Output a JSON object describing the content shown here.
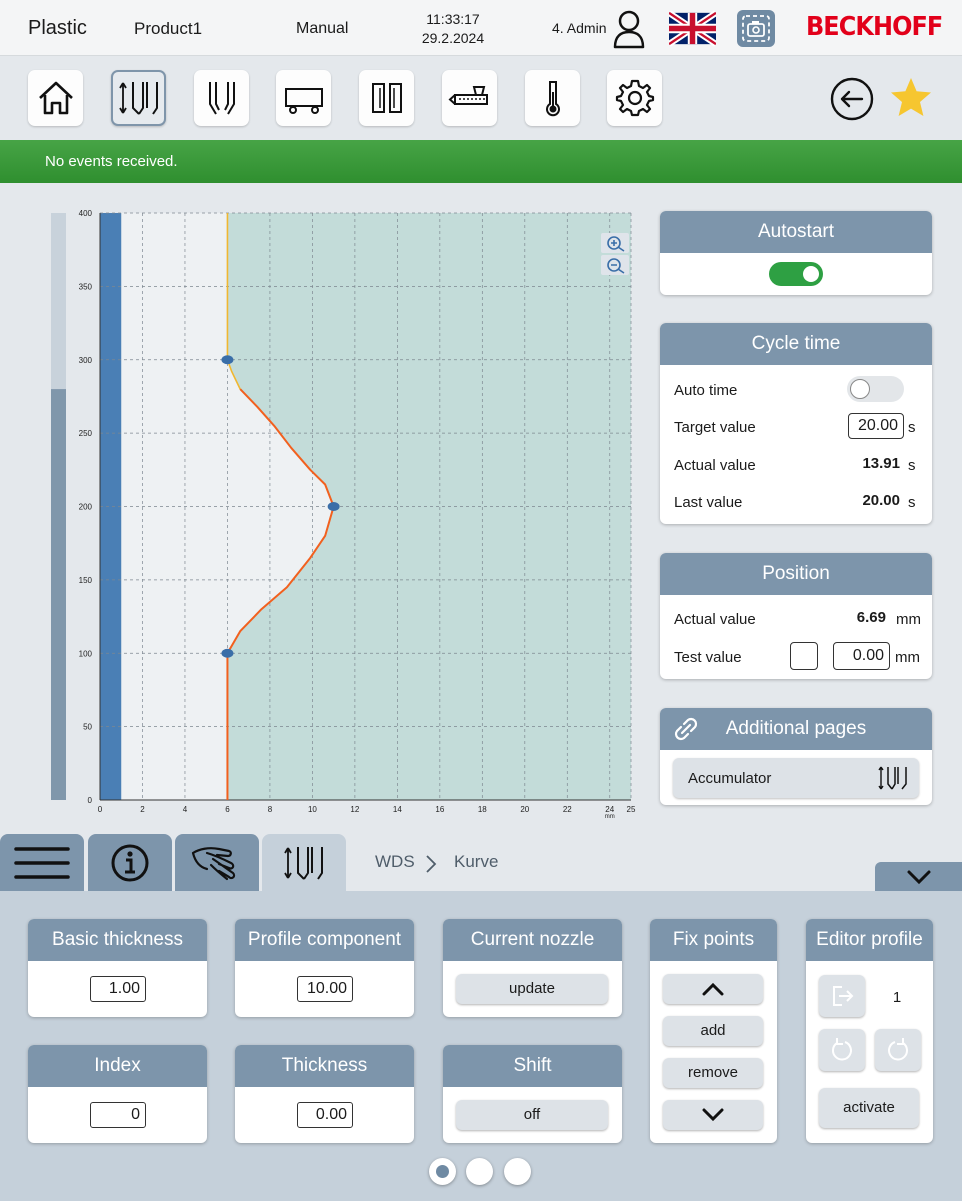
{
  "header": {
    "app_name": "Plastic",
    "product": "Product1",
    "mode": "Manual",
    "time": "11:33:17",
    "date": "29.2.2024",
    "user": "4. Admin",
    "logo": "BECKHOFF"
  },
  "nav": {
    "items": [
      {
        "icon": "home-icon"
      },
      {
        "icon": "wall-thickness-icon",
        "active": true
      },
      {
        "icon": "mold-icon"
      },
      {
        "icon": "carriage-icon"
      },
      {
        "icon": "clamp-icon"
      },
      {
        "icon": "extruder-icon"
      },
      {
        "icon": "thermometer-icon"
      },
      {
        "icon": "settings-gear-icon"
      }
    ],
    "back_icon": "back-arrow-icon",
    "favorite_icon": "star-icon",
    "favorite_color": "#f6c630"
  },
  "events": {
    "message": "No events received.",
    "color": "#3a9a3a"
  },
  "chart_data": {
    "type": "line",
    "x_unit": "mm",
    "xlim": [
      0,
      25
    ],
    "ylim": [
      0,
      400
    ],
    "x_ticks": [
      0,
      2,
      4,
      6,
      8,
      10,
      12,
      14,
      16,
      18,
      20,
      22,
      24,
      25
    ],
    "y_ticks": [
      0,
      50,
      100,
      150,
      200,
      250,
      300,
      350,
      400
    ],
    "grid": true,
    "basic_thickness_x": 6,
    "profile_curve": [
      [
        6,
        0
      ],
      [
        6,
        100
      ],
      [
        6.6,
        115
      ],
      [
        7.6,
        130
      ],
      [
        8.8,
        145
      ],
      [
        9.9,
        165
      ],
      [
        10.6,
        180
      ],
      [
        11,
        200
      ],
      [
        10.6,
        215
      ],
      [
        9.9,
        225
      ],
      [
        9,
        240
      ],
      [
        8.2,
        255
      ],
      [
        7.4,
        268
      ],
      [
        6.6,
        280
      ]
    ],
    "upper_curve": [
      [
        6.6,
        280
      ],
      [
        6.2,
        292
      ],
      [
        6,
        300
      ],
      [
        6,
        400
      ]
    ],
    "fix_points": [
      [
        6,
        100
      ],
      [
        11,
        200
      ],
      [
        6,
        300
      ]
    ],
    "bar_progress": 0.7,
    "zoom_in_icon": "zoom-in-icon",
    "zoom_out_icon": "zoom-out-icon",
    "colors": {
      "area": "#c3dcd9",
      "curve": "#f2601e",
      "upper": "#f0b731",
      "point": "#3a6ea8",
      "bar": "#4a7fb5"
    }
  },
  "autostart": {
    "title": "Autostart",
    "enabled": true
  },
  "cycle_time": {
    "title": "Cycle time",
    "auto_time_label": "Auto time",
    "target_label": "Target value",
    "target_value": "20.00",
    "actual_label": "Actual value",
    "actual_value": "13.91",
    "last_label": "Last value",
    "last_value": "20.00",
    "unit": "s"
  },
  "position": {
    "title": "Position",
    "actual_label": "Actual value",
    "actual_value": "6.69",
    "test_label": "Test value",
    "test_value": "0.00",
    "unit": "mm"
  },
  "additional_pages": {
    "title": "Additional pages",
    "link_icon": "link-icon",
    "selected": "Accumulator"
  },
  "breadcrumb": {
    "items": [
      "WDS",
      "Kurve"
    ]
  },
  "tabs": [
    {
      "icon": "menu-icon"
    },
    {
      "icon": "info-icon"
    },
    {
      "icon": "hand-icon"
    },
    {
      "icon": "wall-thickness-icon",
      "active": true
    }
  ],
  "cards": {
    "basic_thickness": {
      "title": "Basic thickness",
      "value": "1.00"
    },
    "profile_component": {
      "title": "Profile component",
      "value": "10.00"
    },
    "current_nozzle": {
      "title": "Current nozzle",
      "button": "update"
    },
    "index": {
      "title": "Index",
      "value": "0"
    },
    "thickness": {
      "title": "Thickness",
      "value": "0.00"
    },
    "shift": {
      "title": "Shift",
      "button": "off"
    },
    "fix_points": {
      "title": "Fix points",
      "add": "add",
      "remove": "remove"
    },
    "editor_profile": {
      "title": "Editor profile",
      "value": "1",
      "activate": "activate"
    }
  },
  "pager": {
    "pages": 3,
    "current": 1
  }
}
